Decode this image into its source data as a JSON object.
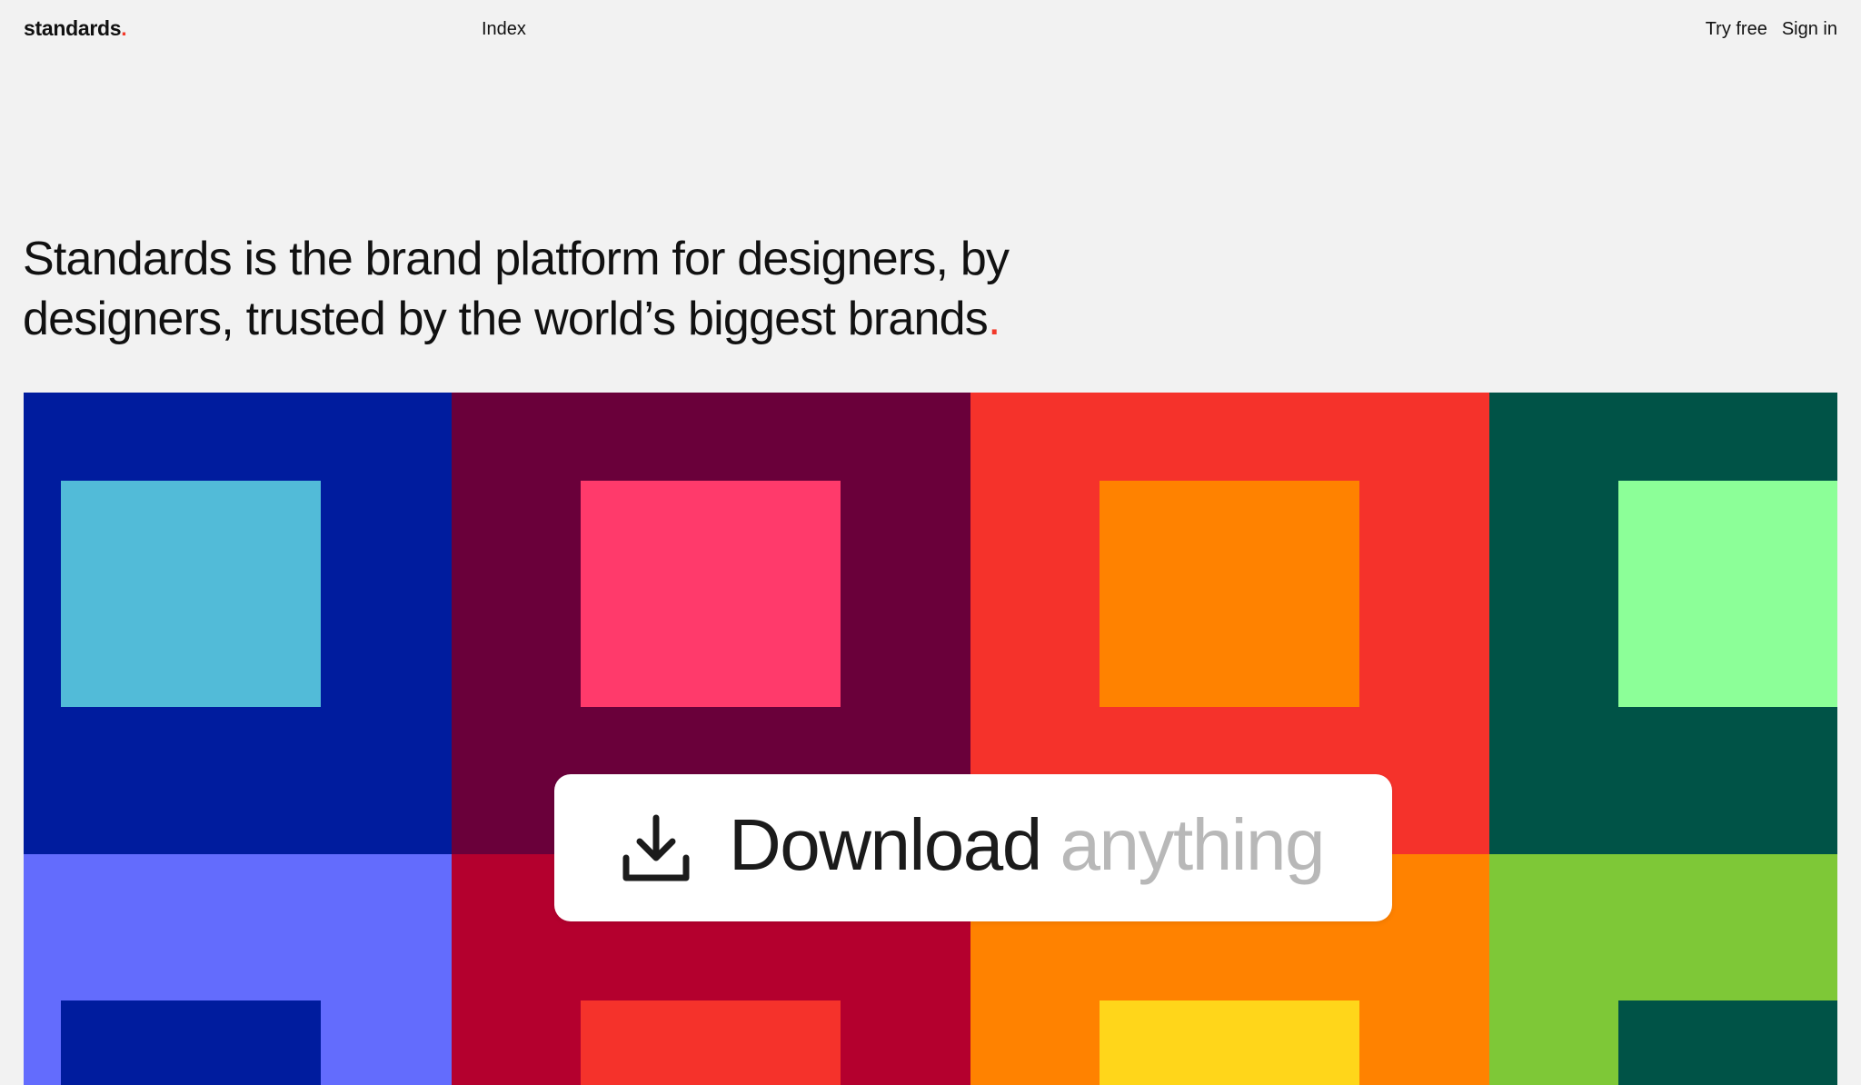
{
  "header": {
    "logo_text": "standards",
    "logo_dot": ".",
    "nav_index": "Index",
    "try_free": "Try free",
    "sign_in": "Sign in"
  },
  "hero": {
    "line1": "Standards is the brand platform for designers, by",
    "line2": "designers, trusted by the world’s biggest brands",
    "end_dot": "."
  },
  "download_card": {
    "word": "Download",
    "muted_word": "anything",
    "icon": "download-icon"
  },
  "colors": {
    "accent": "#f2392a",
    "row1": [
      "#001c9e",
      "#6a003a",
      "#f5322b",
      "#005347"
    ],
    "row1_inner": [
      "#52bbd8",
      "#ff3a6b",
      "#ff8200",
      "#8cff98"
    ],
    "row2": [
      "#636cfd",
      "#b4002e",
      "#ff8200",
      "#7ec837"
    ],
    "row2_inner": [
      "#001c9e",
      "#f5322b",
      "#ffd61a",
      "#005347"
    ]
  }
}
